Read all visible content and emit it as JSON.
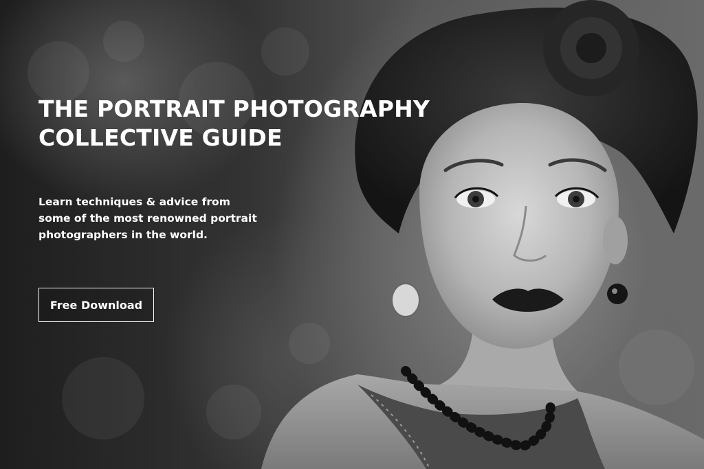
{
  "hero": {
    "title_lines": [
      "THE PORTRAIT PHOTOGRAPHY",
      "COLLECTIVE GUIDE"
    ],
    "description_lines": [
      "Learn techniques & advice from",
      "some of the most renowned portrait",
      "photographers in the world."
    ],
    "cta_label": "Free Download"
  },
  "colors": {
    "text": "#ffffff",
    "cta_border": "#ffffff"
  }
}
